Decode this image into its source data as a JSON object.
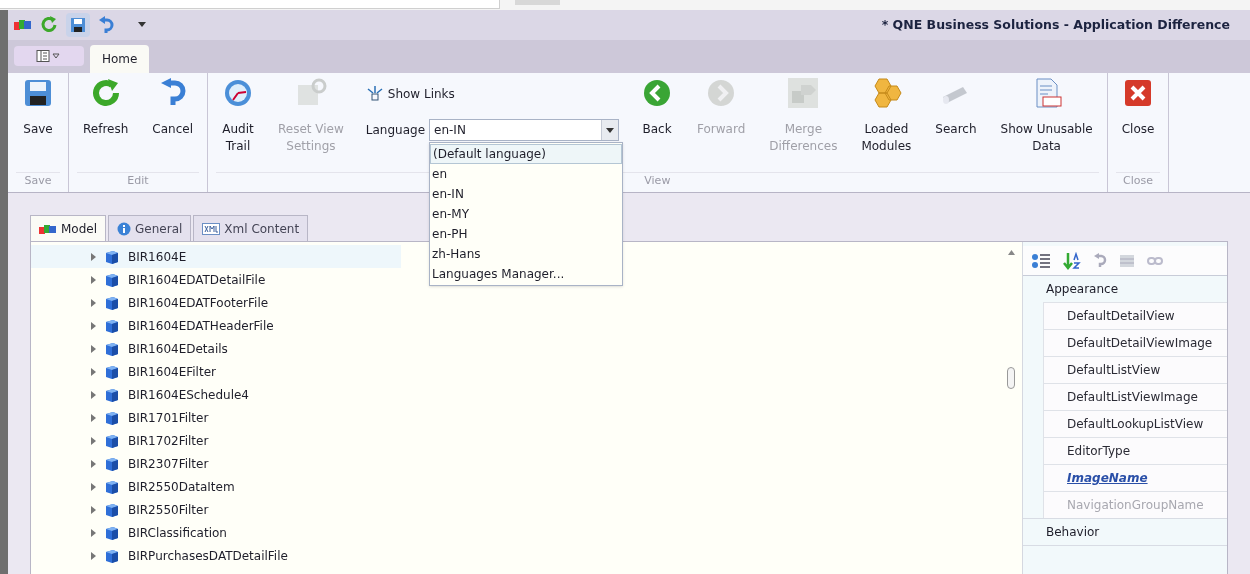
{
  "window": {
    "title": "* QNE Business Solutions - Application Difference"
  },
  "ribbon_tabs": [
    {
      "label": "Home",
      "selected": true
    }
  ],
  "ribbon_groups": [
    {
      "caption": "Save",
      "items": [
        {
          "kind": "large",
          "label": "Save",
          "disabled": false
        }
      ]
    },
    {
      "caption": "Edit",
      "items": [
        {
          "kind": "large",
          "label": "Refresh",
          "disabled": false
        },
        {
          "kind": "large",
          "label": "Cancel",
          "disabled": false
        }
      ]
    },
    {
      "caption": "View",
      "items": [
        {
          "kind": "large",
          "label": "Audit\nTrail",
          "disabled": false
        },
        {
          "kind": "large",
          "label": "Reset View\nSettings",
          "disabled": true
        },
        {
          "kind": "column",
          "link": {
            "label": "Show Links",
            "disabled": false
          },
          "combo": {
            "label": "Language",
            "value": "en-IN"
          }
        },
        {
          "kind": "large",
          "label": "Back",
          "disabled": false
        },
        {
          "kind": "large",
          "label": "Forward",
          "disabled": true
        },
        {
          "kind": "large",
          "label": "Merge\nDifferences",
          "disabled": true
        },
        {
          "kind": "large",
          "label": "Loaded\nModules",
          "disabled": false
        },
        {
          "kind": "large",
          "label": "Search",
          "disabled": false
        },
        {
          "kind": "large",
          "label": "Show Unusable\nData",
          "disabled": false
        }
      ]
    },
    {
      "caption": "Close",
      "items": [
        {
          "kind": "large",
          "label": "Close",
          "disabled": false
        }
      ]
    }
  ],
  "language_dropdown": [
    {
      "label": "(Default language)",
      "selected": true
    },
    {
      "label": "en",
      "selected": false
    },
    {
      "label": "en-IN",
      "selected": false
    },
    {
      "label": "en-MY",
      "selected": false
    },
    {
      "label": "en-PH",
      "selected": false
    },
    {
      "label": "zh-Hans",
      "selected": false
    },
    {
      "label": "Languages Manager...",
      "selected": false
    }
  ],
  "content_tabs": [
    {
      "label": "Model",
      "selected": true
    },
    {
      "label": "General",
      "selected": false
    },
    {
      "label": "Xml Content",
      "selected": false
    }
  ],
  "tree": [
    {
      "label": "BIR1604E",
      "selected": true
    },
    {
      "label": "BIR1604EDATDetailFile",
      "selected": false
    },
    {
      "label": "BIR1604EDATFooterFile",
      "selected": false
    },
    {
      "label": "BIR1604EDATHeaderFile",
      "selected": false
    },
    {
      "label": "BIR1604EDetails",
      "selected": false
    },
    {
      "label": "BIR1604EFilter",
      "selected": false
    },
    {
      "label": "BIR1604ESchedule4",
      "selected": false
    },
    {
      "label": "BIR1701Filter",
      "selected": false
    },
    {
      "label": "BIR1702Filter",
      "selected": false
    },
    {
      "label": "BIR2307Filter",
      "selected": false
    },
    {
      "label": "BIR2550DataItem",
      "selected": false
    },
    {
      "label": "BIR2550Filter",
      "selected": false
    },
    {
      "label": "BIRClassification",
      "selected": false
    },
    {
      "label": "BIRPurchasesDATDetailFile",
      "selected": false
    }
  ],
  "properties": [
    {
      "category": "Appearance",
      "items": [
        {
          "label": "DefaultDetailView",
          "kind": "normal"
        },
        {
          "label": "DefaultDetailViewImage",
          "kind": "normal"
        },
        {
          "label": "DefaultListView",
          "kind": "normal"
        },
        {
          "label": "DefaultListViewImage",
          "kind": "normal"
        },
        {
          "label": "DefaultLookupListView",
          "kind": "normal"
        },
        {
          "label": "EditorType",
          "kind": "normal"
        },
        {
          "label": "ImageName",
          "kind": "modified"
        },
        {
          "label": "NavigationGroupName",
          "kind": "readonly"
        }
      ]
    },
    {
      "category": "Behavior"
    }
  ]
}
